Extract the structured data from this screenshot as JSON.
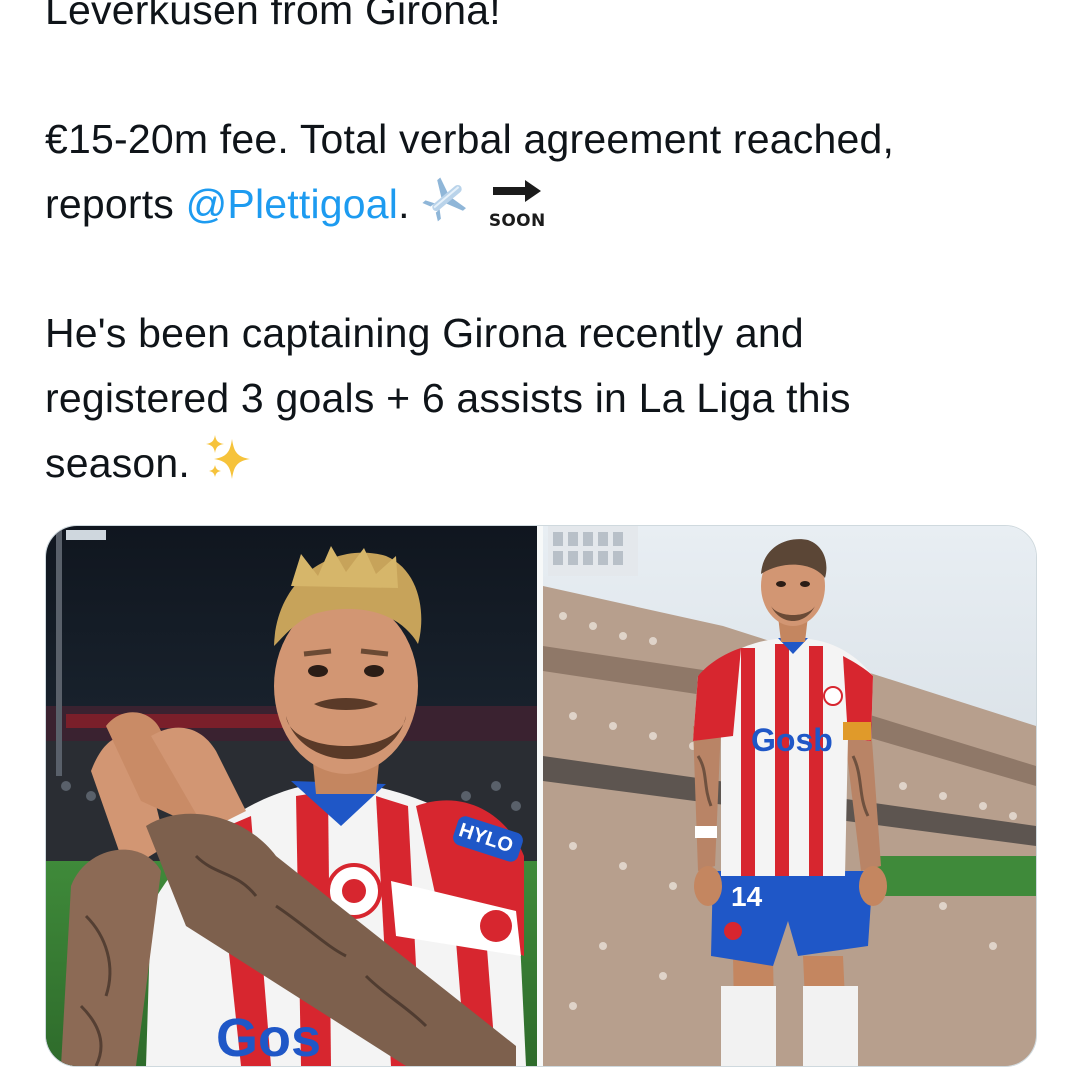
{
  "tweet": {
    "line1": "Leverkusen from Girona!",
    "line2": "€15-20m fee. Total verbal agreement reached,",
    "line3_prefix": "reports ",
    "mention": "@Plettigoal",
    "line3_suffix": ".",
    "soon_label": "SOON",
    "line4": "He's been captaining Girona recently and",
    "line5": "registered 3 goals + 6 assists in La Liga this",
    "line6": "season."
  },
  "icons": {
    "airplane": "airplane-icon",
    "soon_arrow": "soon-arrow-icon",
    "sparkles": "sparkles-icon"
  },
  "media": {
    "left_shirt_text": "Gos",
    "left_sleeve_text": "HYLO",
    "right_shirt_text": "Gosb",
    "right_shorts_number": "14"
  },
  "colors": {
    "text": "#0f1419",
    "mention": "#1d9bf0",
    "background": "#ffffff",
    "girona_red": "#d7262f",
    "shorts_blue": "#1f57c7"
  }
}
